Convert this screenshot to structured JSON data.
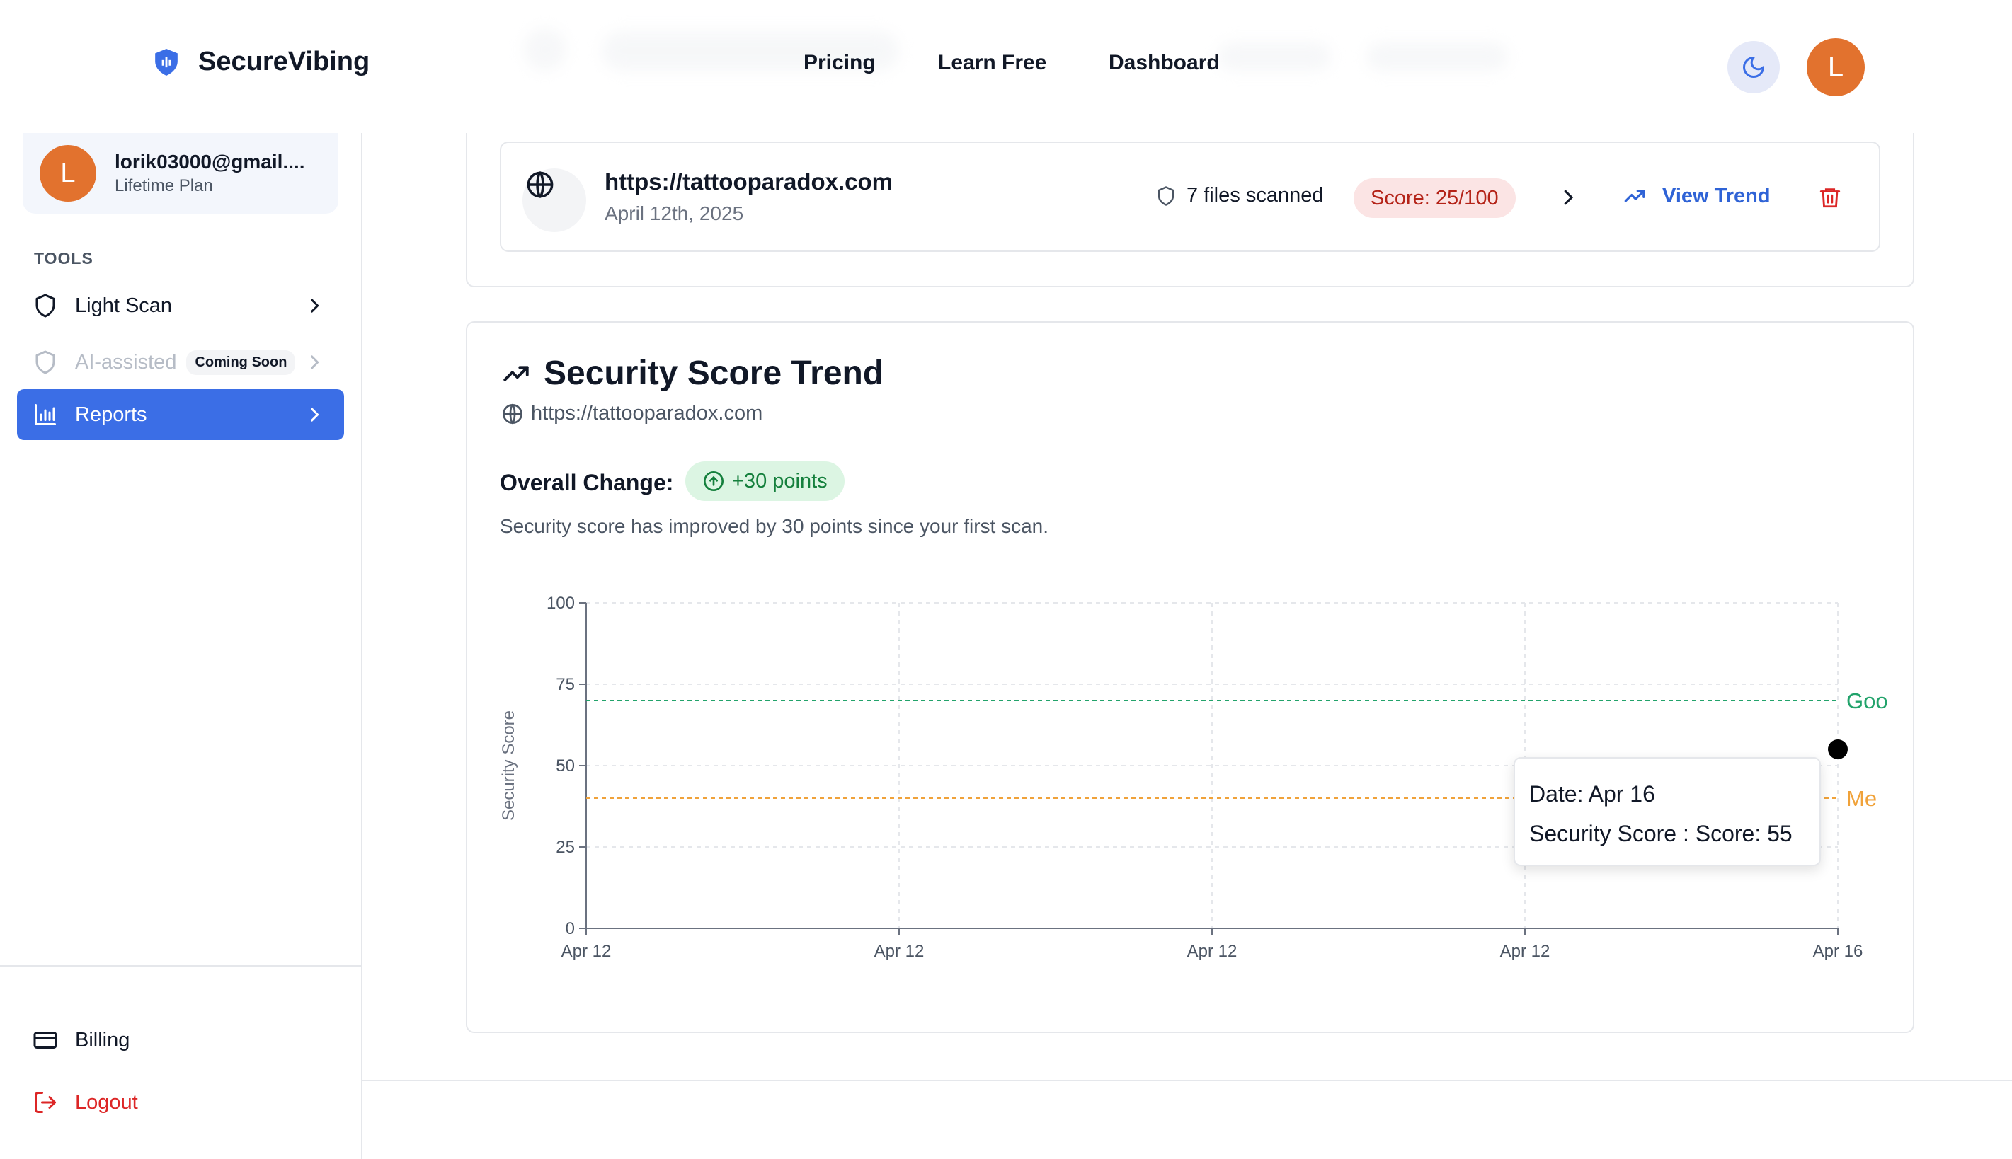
{
  "brand": {
    "name": "SecureVibing"
  },
  "nav": {
    "items": [
      "Pricing",
      "Learn Free",
      "Dashboard"
    ]
  },
  "user": {
    "initial": "L",
    "email": "lorik03000@gmail....",
    "plan": "Lifetime Plan"
  },
  "sidebar": {
    "tools_heading": "TOOLS",
    "items": [
      {
        "label": "Light Scan",
        "state": "normal"
      },
      {
        "label": "AI-assisted",
        "badge": "Coming Soon",
        "state": "disabled"
      },
      {
        "label": "Reports",
        "state": "active"
      }
    ],
    "billing": "Billing",
    "logout": "Logout"
  },
  "scan": {
    "url": "https://tattooparadox.com",
    "date": "April 12th, 2025",
    "files": "7 files scanned",
    "score": "Score: 25/100",
    "view_trend": "View Trend"
  },
  "trend": {
    "title": "Security Score Trend",
    "url": "https://tattooparadox.com",
    "overall_label": "Overall Change:",
    "change": "+30 points",
    "description": "Security score has improved by 30 points since your first scan."
  },
  "tooltip": {
    "date": "Date: Apr 16",
    "score": "Security Score : Score: 55"
  },
  "colors": {
    "accent": "#3b6ee6",
    "avatar": "#e2722e",
    "good": "#22a36b",
    "medium": "#f0a23a",
    "danger": "#dc2626"
  },
  "chart_data": {
    "type": "line",
    "ylabel": "Security Score",
    "xlabel": "",
    "ylim": [
      0,
      100
    ],
    "yticks": [
      0,
      25,
      50,
      75,
      100
    ],
    "x": [
      "Apr 12",
      "Apr 12",
      "Apr 12",
      "Apr 12",
      "Apr 16"
    ],
    "series": [
      {
        "values": [
          null,
          null,
          null,
          null,
          55
        ]
      }
    ],
    "reference_lines": [
      {
        "label": "Goo",
        "value": 70,
        "color": "#22a36b"
      },
      {
        "label": "Me",
        "value": 40,
        "color": "#f0a23a"
      }
    ],
    "grid": true
  }
}
